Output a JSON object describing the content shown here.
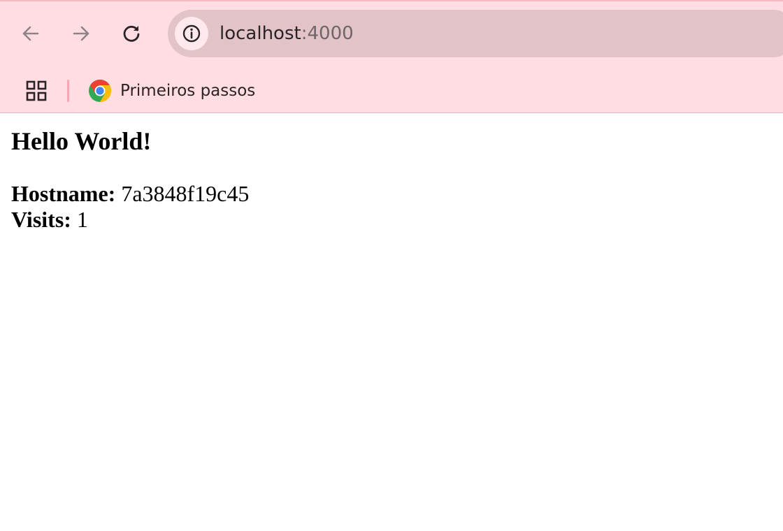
{
  "browser": {
    "url_host": "localhost",
    "url_port": ":4000",
    "bookmarks": [
      {
        "label": "Primeiros passos",
        "icon": "chrome-icon"
      }
    ],
    "theme_color": "#ffdde2"
  },
  "page": {
    "heading": "Hello World!",
    "hostname_label": "Hostname:",
    "hostname_value": "7a3848f19c45",
    "visits_label": "Visits:",
    "visits_value": "1"
  }
}
